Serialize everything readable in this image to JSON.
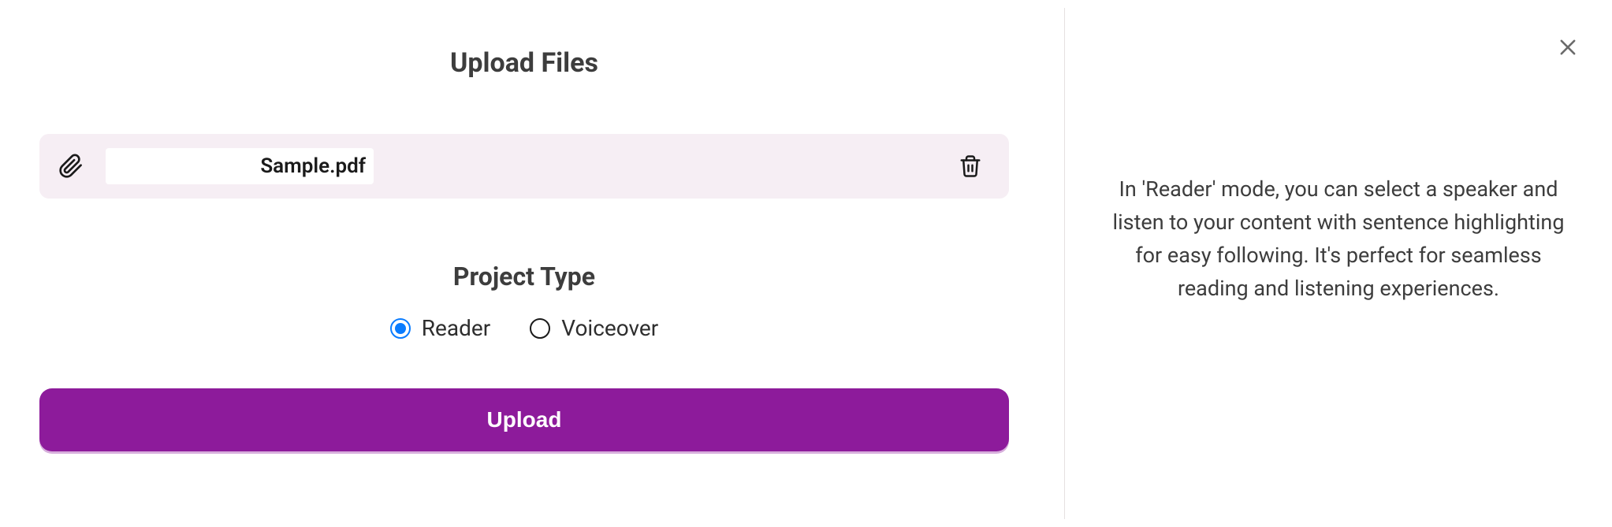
{
  "upload": {
    "title": "Upload Files",
    "file": {
      "name": "Sample.pdf"
    },
    "projectType": {
      "title": "Project Type",
      "options": {
        "reader": "Reader",
        "voiceover": "Voiceover"
      },
      "selected": "reader"
    },
    "button": "Upload"
  },
  "info": {
    "text": "In 'Reader' mode, you can select a speaker and listen to your content with sentence highlighting for easy following. It's perfect for seamless reading and listening experiences."
  },
  "colors": {
    "primary": "#8d1b9b",
    "radioSelected": "#0a7cff",
    "fileRowBg": "#f6eef4"
  }
}
